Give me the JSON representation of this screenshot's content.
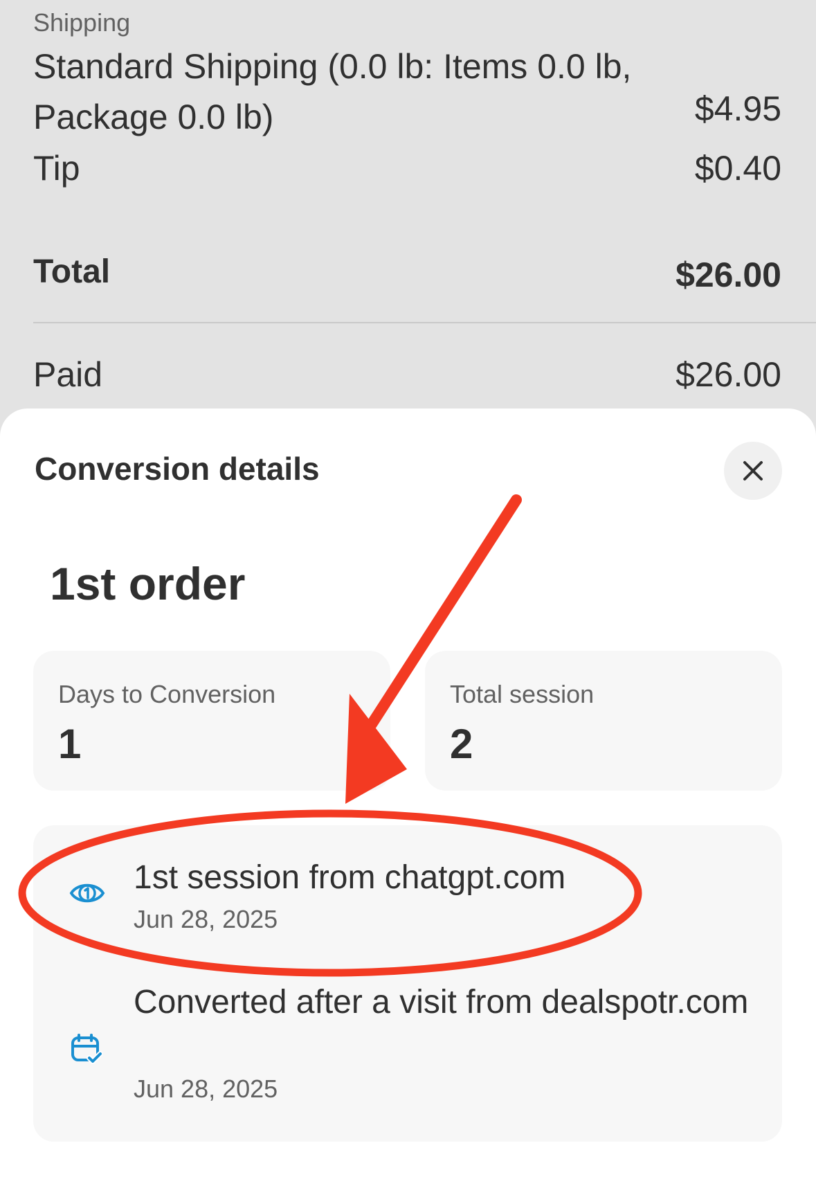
{
  "summary": {
    "shipping_label": "Shipping",
    "shipping_desc": "Standard Shipping (0.0 lb: Items 0.0 lb, Package 0.0 lb)",
    "shipping_amount": "$4.95",
    "tip_label": "Tip",
    "tip_amount": "$0.40",
    "total_label": "Total",
    "total_amount": "$26.00",
    "paid_label": "Paid",
    "paid_amount": "$26.00"
  },
  "sheet": {
    "title": "Conversion details",
    "order_title": "1st order",
    "stats": [
      {
        "label": "Days to Conversion",
        "value": "1"
      },
      {
        "label": "Total session",
        "value": "2"
      }
    ],
    "timeline": [
      {
        "title": "1st session from chatgpt.com",
        "date": "Jun 28, 2025",
        "icon": "first-session-icon"
      },
      {
        "title": "Converted after a visit from dealspotr.com",
        "date": "Jun 28, 2025",
        "icon": "calendar-check-icon"
      }
    ]
  },
  "colors": {
    "annotation_red": "#f33a22",
    "icon_blue": "#1a8fd1"
  }
}
